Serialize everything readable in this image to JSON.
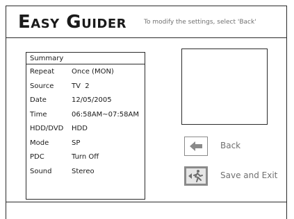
{
  "header": {
    "title": "Easy Guider",
    "hint": "To modify the settings, select 'Back'"
  },
  "summary": {
    "title": "Summary",
    "rows": [
      {
        "label": "Repeat",
        "value": "Once (MON)"
      },
      {
        "label": "Source",
        "value": "TV  2"
      },
      {
        "label": "Date",
        "value": "12/05/2005"
      },
      {
        "label": "Time",
        "value": "06:58AM~07:58AM"
      },
      {
        "label": "HDD/DVD",
        "value": "HDD"
      },
      {
        "label": "Mode",
        "value": "SP"
      },
      {
        "label": "PDC",
        "value": "Turn Off"
      },
      {
        "label": "Sound",
        "value": "Stereo"
      }
    ]
  },
  "buttons": {
    "back": {
      "label": "Back",
      "icon": "left-arrow-icon"
    },
    "save_exit": {
      "label": "Save and Exit",
      "icon": "exit-running-figure-icon"
    }
  },
  "colors": {
    "border": "#2a2a2a",
    "muted_text": "#707070",
    "icon_gray": "#8a8a8a",
    "selected_fill": "#e6e6e6"
  }
}
